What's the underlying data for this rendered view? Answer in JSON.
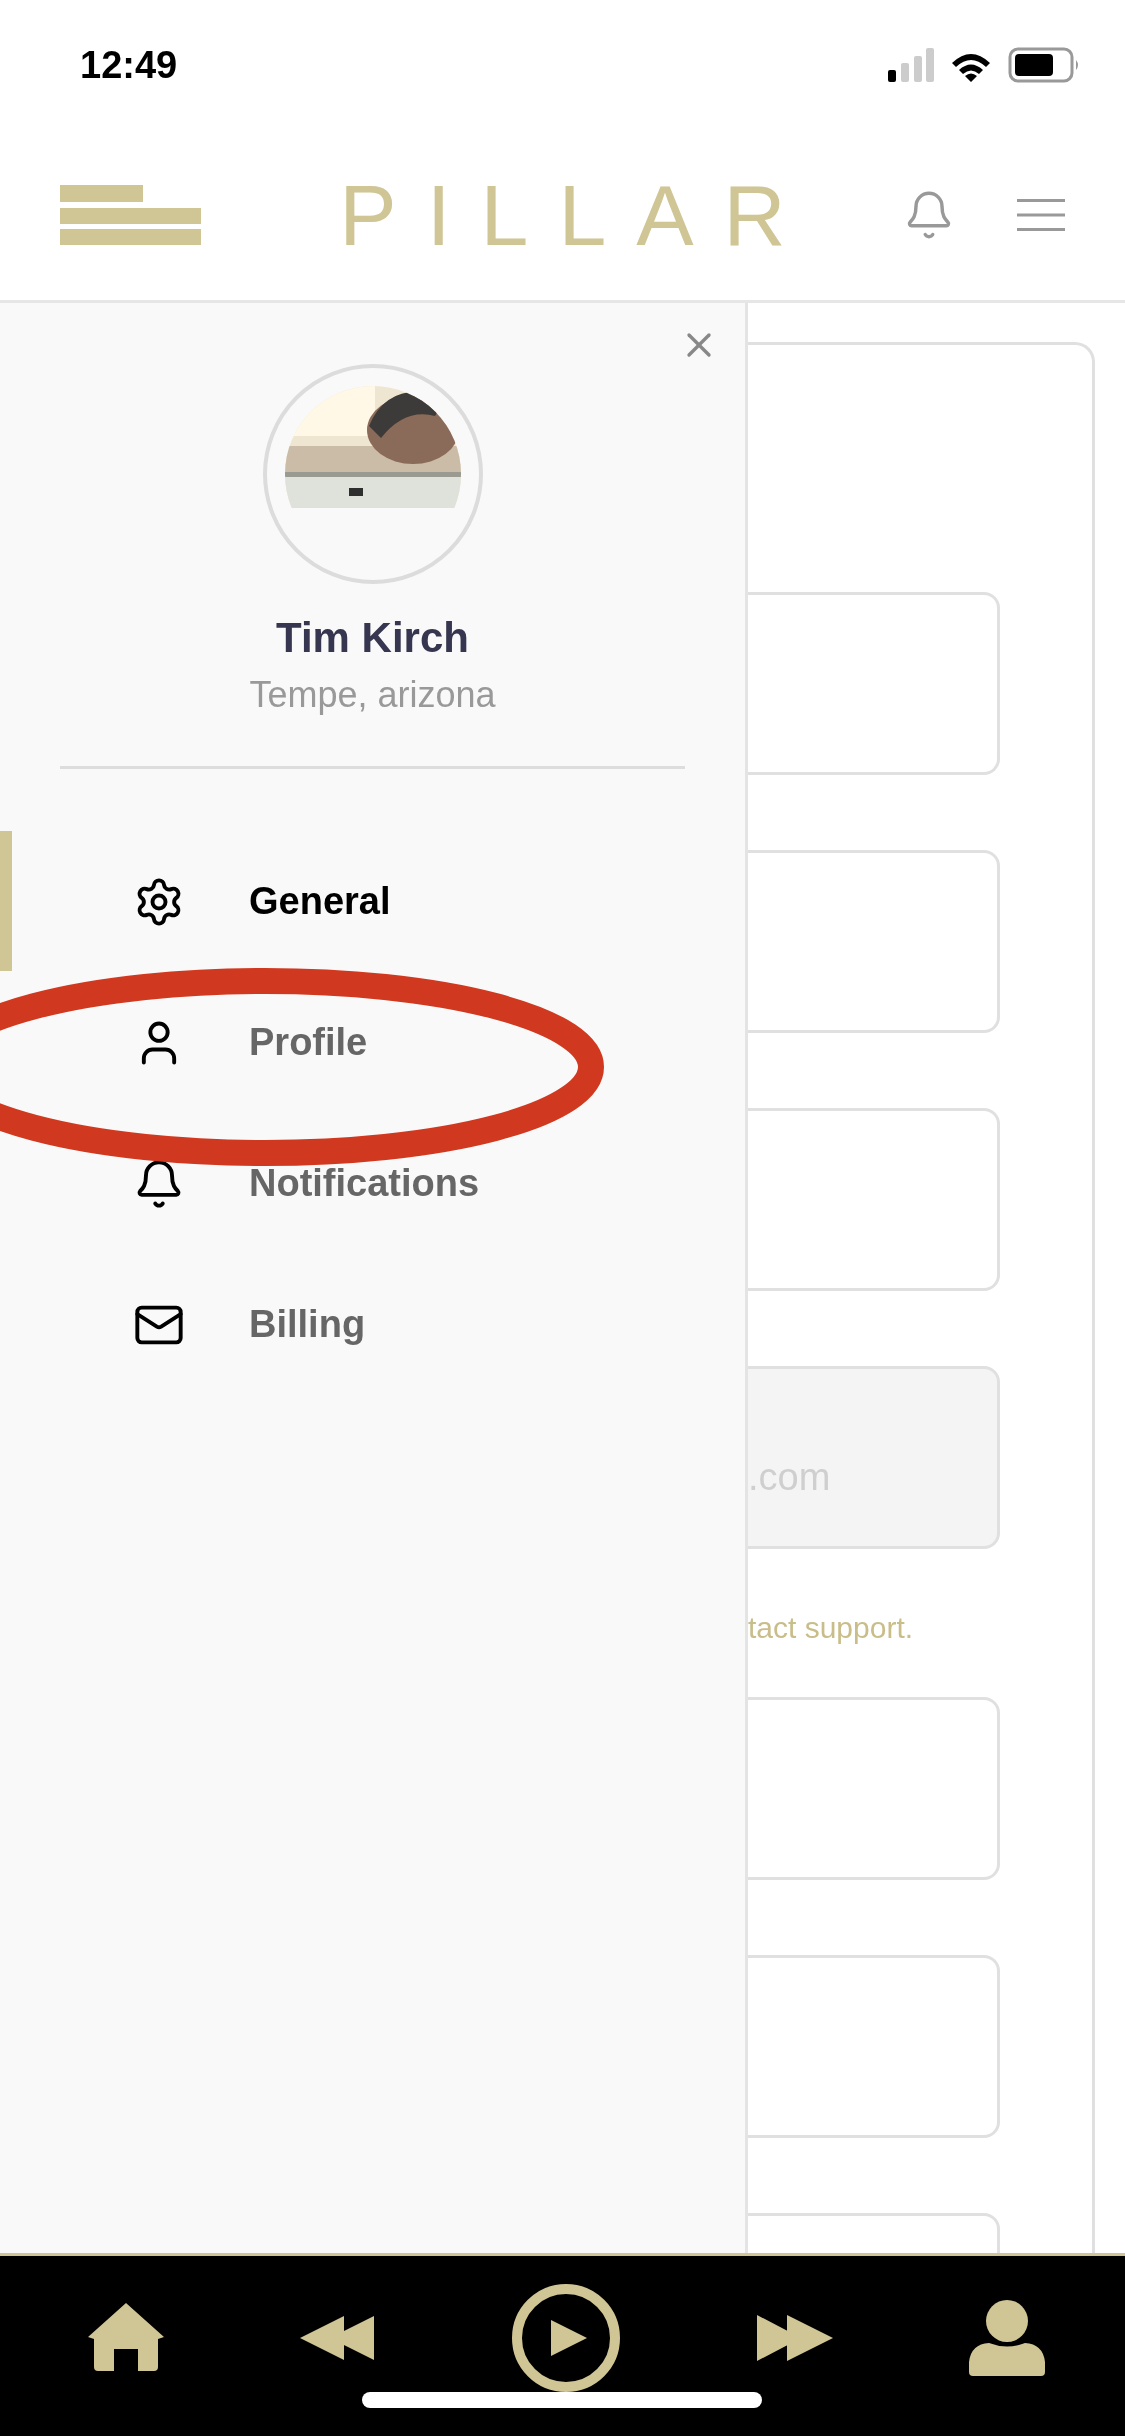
{
  "status_bar": {
    "time": "12:49"
  },
  "header": {
    "logo": "PILLAR"
  },
  "drawer": {
    "profile": {
      "name": "Tim Kirch",
      "location": "Tempe, arizona"
    },
    "items": [
      {
        "label": "General",
        "selected": true
      },
      {
        "label": "Profile",
        "selected": false
      },
      {
        "label": "Notifications",
        "selected": false
      },
      {
        "label": "Billing",
        "selected": false
      }
    ]
  },
  "form": [
    {
      "kind": "field"
    },
    {
      "kind": "field"
    },
    {
      "kind": "field"
    },
    {
      "kind": "field",
      "value": ".com",
      "disabled": true
    },
    {
      "kind": "note",
      "text": "tact support."
    },
    {
      "kind": "field"
    },
    {
      "kind": "field"
    },
    {
      "kind": "field"
    }
  ],
  "annotation": {
    "color": "#d0391f"
  }
}
